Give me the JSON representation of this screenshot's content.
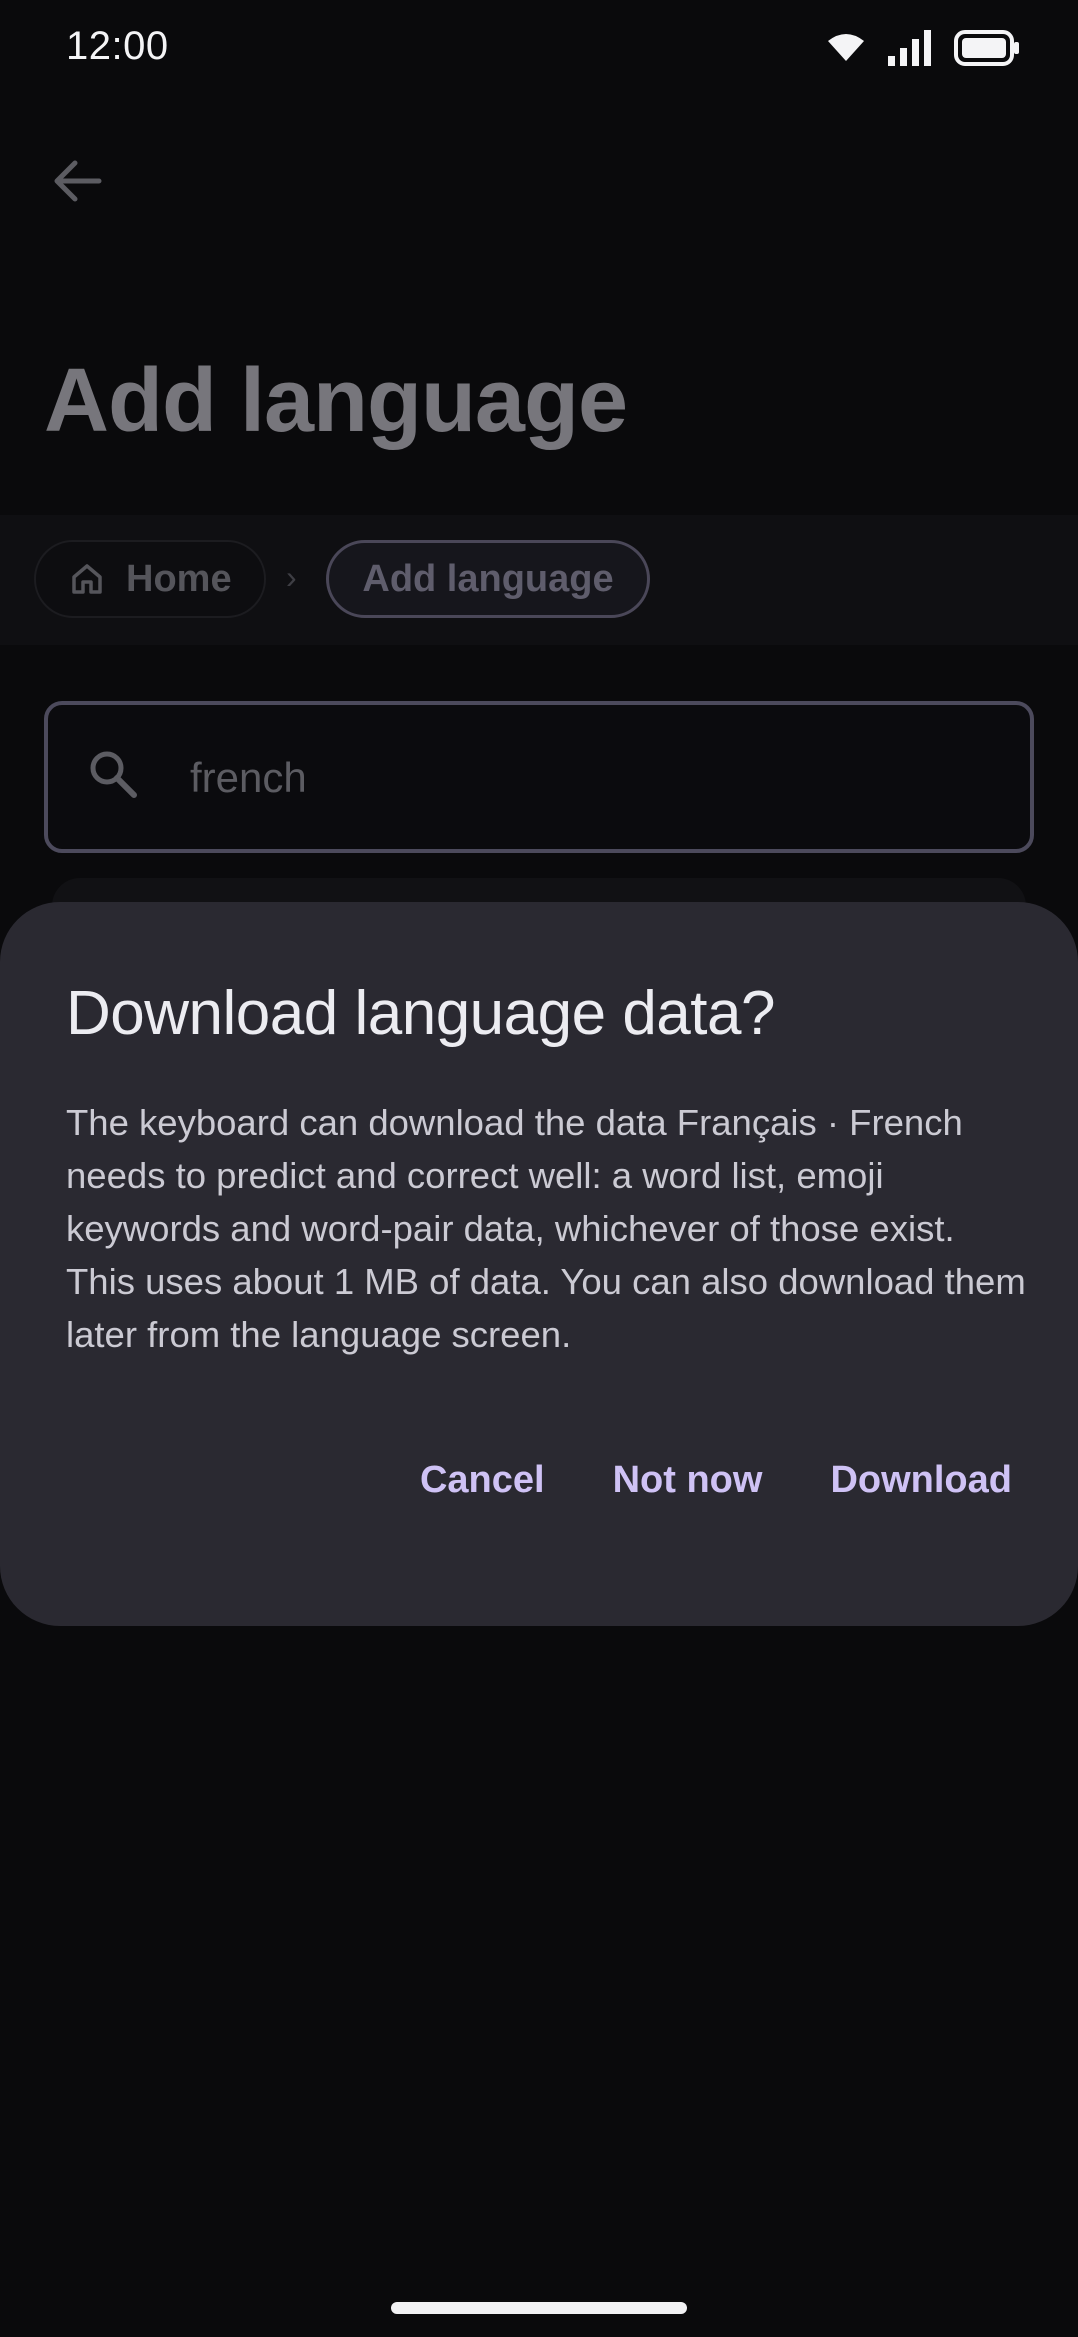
{
  "status_bar": {
    "time": "12:00",
    "icons": [
      "wifi-icon",
      "signal-icon",
      "battery-icon"
    ]
  },
  "header": {
    "back_icon": "arrow-left-icon",
    "title": "Add language"
  },
  "breadcrumb": {
    "items": [
      {
        "label": "Home",
        "icon": "home-icon"
      },
      {
        "label": "Add language"
      }
    ],
    "separator": "›"
  },
  "search": {
    "icon": "search-icon",
    "value": "french"
  },
  "dialog": {
    "title": "Download language data?",
    "body": "The keyboard can download the data Français · French needs to predict and correct well: a word list, emoji keywords and word-pair data, whichever of those exist. This uses about 1 MB of data. You can also download them later from the language screen.",
    "buttons": {
      "cancel": "Cancel",
      "not_now": "Not now",
      "download": "Download"
    }
  },
  "colors": {
    "background": "#0a0a0c",
    "dialog_surface": "#2a2931",
    "accent": "#cfc2f5"
  }
}
